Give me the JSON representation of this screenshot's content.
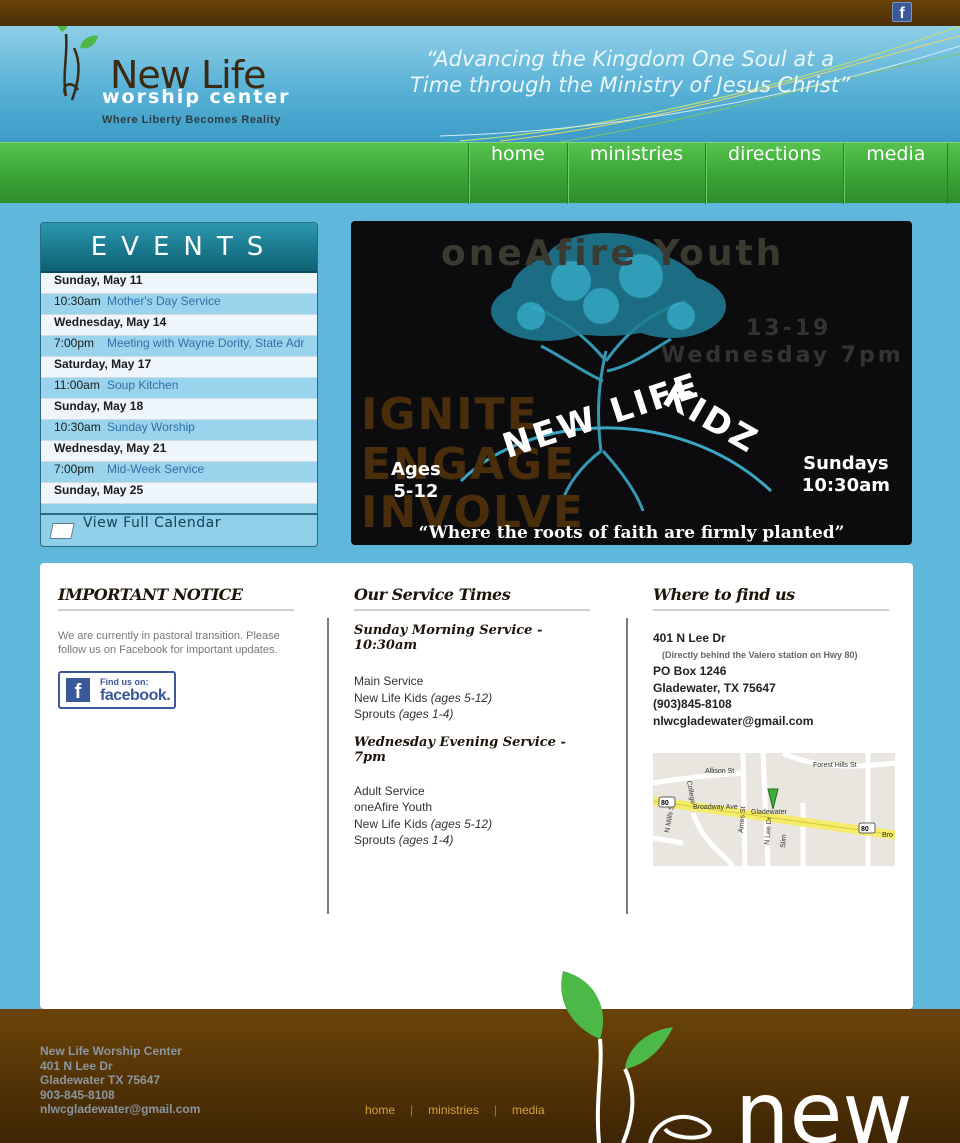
{
  "header": {
    "brand_name": "New Life",
    "brand_sub": "worship center",
    "brand_tagline": "Where Liberty Becomes Reality",
    "slogan_line1": "“Advancing the Kingdom One Soul at a",
    "slogan_line2": "Time through the Ministry of Jesus Christ”",
    "facebook_icon": "facebook-icon"
  },
  "nav": {
    "items": [
      {
        "label": "home"
      },
      {
        "label": "ministries"
      },
      {
        "label": "directions"
      },
      {
        "label": "media"
      }
    ]
  },
  "events": {
    "title": "EVENTS",
    "days": [
      {
        "day": "Sunday, May 11",
        "time": "10:30am",
        "name": "Mother's Day Service"
      },
      {
        "day": "Wednesday, May 14",
        "time": "7:00pm",
        "name": "Meeting with Wayne Dority, State Adr"
      },
      {
        "day": "Saturday, May 17",
        "time": "11:00am",
        "name": "Soup Kitchen"
      },
      {
        "day": "Sunday, May 18",
        "time": "10:30am",
        "name": "Sunday Worship"
      },
      {
        "day": "Wednesday, May 21",
        "time": "7:00pm",
        "name": "Mid-Week Service"
      },
      {
        "day": "Sunday, May 25",
        "time": "",
        "name": ""
      }
    ],
    "calendar_link": "View Full Calendar"
  },
  "banner": {
    "bg_text_1": "oneAfire Youth",
    "bg_text_2": "13-19",
    "bg_text_3": "Wednesday 7pm",
    "bg_text_4": "IGNITE",
    "bg_text_5": "ENGAGE",
    "bg_text_6": "INVOLVE",
    "kidz_left": "NEW LIFE",
    "kidz_right": "KIDZ",
    "ages_label": "Ages",
    "ages_value": "5-12",
    "sundays_label": "Sundays",
    "sundays_time": "10:30am",
    "quote": "“Where the roots of faith are firmly planted”"
  },
  "notice": {
    "heading": "IMPORTANT NOTICE",
    "text": "We are currently in pastoral transition. Please follow us on Facebook for important updates.",
    "badge_line1": "Find us on:",
    "badge_line2": "facebook."
  },
  "services": {
    "heading": "Our Service Times",
    "sunday_heading": "Sunday Morning Service - 10:30am",
    "sunday_items": [
      {
        "name": "Main Service",
        "note": ""
      },
      {
        "name": "New Life Kids",
        "note": "(ages 5-12)"
      },
      {
        "name": "Sprouts",
        "note": "(ages 1-4)"
      }
    ],
    "wednesday_heading": "Wednesday Evening Service - 7pm",
    "wednesday_items": [
      {
        "name": "Adult Service",
        "note": ""
      },
      {
        "name": "oneAfire Youth",
        "note": ""
      },
      {
        "name": "New Life Kids",
        "note": "(ages 5-12)"
      },
      {
        "name": "Sprouts",
        "note": "(ages 1-4)"
      }
    ]
  },
  "location": {
    "heading": "Where to find us",
    "street": "401 N Lee Dr",
    "note": "(Directly behind the Valero station on Hwy 80)",
    "po_box": "PO Box 1246",
    "city": "Gladewater, TX 75647",
    "phone": "(903)845-8108",
    "email": "nlwcgladewater@gmail.com",
    "map": {
      "labels": [
        "Allison St",
        "Forest Hills St",
        "Broadway Ave",
        "Gladewater",
        "College",
        "Ames St",
        "N Lee Dr",
        "Slim",
        "N Mills St",
        "80",
        "Bro"
      ]
    }
  },
  "footer": {
    "name": "New Life Worship Center",
    "street": "401 N Lee Dr",
    "city": "Gladewater TX 75647",
    "phone": "903-845-8108",
    "email": "nlwcgladewater@gmail.com",
    "links": [
      {
        "label": "home"
      },
      {
        "label": "ministries"
      },
      {
        "label": "media"
      }
    ],
    "separator": "|",
    "logo_text": "new"
  },
  "colors": {
    "brown": "#6b4308",
    "sky": "#5fb7dc",
    "green": "#3aa336",
    "link_blue": "#2f6fa8"
  }
}
